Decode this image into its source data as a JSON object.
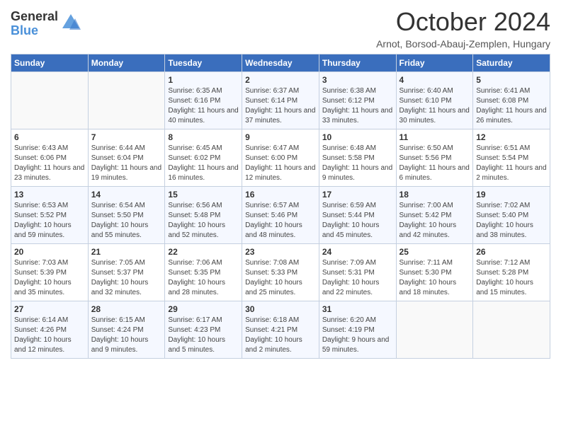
{
  "logo": {
    "general": "General",
    "blue": "Blue"
  },
  "title": "October 2024",
  "subtitle": "Arnot, Borsod-Abauj-Zemplen, Hungary",
  "days_of_week": [
    "Sunday",
    "Monday",
    "Tuesday",
    "Wednesday",
    "Thursday",
    "Friday",
    "Saturday"
  ],
  "weeks": [
    [
      {
        "day": "",
        "info": ""
      },
      {
        "day": "",
        "info": ""
      },
      {
        "day": "1",
        "info": "Sunrise: 6:35 AM\nSunset: 6:16 PM\nDaylight: 11 hours and 40 minutes."
      },
      {
        "day": "2",
        "info": "Sunrise: 6:37 AM\nSunset: 6:14 PM\nDaylight: 11 hours and 37 minutes."
      },
      {
        "day": "3",
        "info": "Sunrise: 6:38 AM\nSunset: 6:12 PM\nDaylight: 11 hours and 33 minutes."
      },
      {
        "day": "4",
        "info": "Sunrise: 6:40 AM\nSunset: 6:10 PM\nDaylight: 11 hours and 30 minutes."
      },
      {
        "day": "5",
        "info": "Sunrise: 6:41 AM\nSunset: 6:08 PM\nDaylight: 11 hours and 26 minutes."
      }
    ],
    [
      {
        "day": "6",
        "info": "Sunrise: 6:43 AM\nSunset: 6:06 PM\nDaylight: 11 hours and 23 minutes."
      },
      {
        "day": "7",
        "info": "Sunrise: 6:44 AM\nSunset: 6:04 PM\nDaylight: 11 hours and 19 minutes."
      },
      {
        "day": "8",
        "info": "Sunrise: 6:45 AM\nSunset: 6:02 PM\nDaylight: 11 hours and 16 minutes."
      },
      {
        "day": "9",
        "info": "Sunrise: 6:47 AM\nSunset: 6:00 PM\nDaylight: 11 hours and 12 minutes."
      },
      {
        "day": "10",
        "info": "Sunrise: 6:48 AM\nSunset: 5:58 PM\nDaylight: 11 hours and 9 minutes."
      },
      {
        "day": "11",
        "info": "Sunrise: 6:50 AM\nSunset: 5:56 PM\nDaylight: 11 hours and 6 minutes."
      },
      {
        "day": "12",
        "info": "Sunrise: 6:51 AM\nSunset: 5:54 PM\nDaylight: 11 hours and 2 minutes."
      }
    ],
    [
      {
        "day": "13",
        "info": "Sunrise: 6:53 AM\nSunset: 5:52 PM\nDaylight: 10 hours and 59 minutes."
      },
      {
        "day": "14",
        "info": "Sunrise: 6:54 AM\nSunset: 5:50 PM\nDaylight: 10 hours and 55 minutes."
      },
      {
        "day": "15",
        "info": "Sunrise: 6:56 AM\nSunset: 5:48 PM\nDaylight: 10 hours and 52 minutes."
      },
      {
        "day": "16",
        "info": "Sunrise: 6:57 AM\nSunset: 5:46 PM\nDaylight: 10 hours and 48 minutes."
      },
      {
        "day": "17",
        "info": "Sunrise: 6:59 AM\nSunset: 5:44 PM\nDaylight: 10 hours and 45 minutes."
      },
      {
        "day": "18",
        "info": "Sunrise: 7:00 AM\nSunset: 5:42 PM\nDaylight: 10 hours and 42 minutes."
      },
      {
        "day": "19",
        "info": "Sunrise: 7:02 AM\nSunset: 5:40 PM\nDaylight: 10 hours and 38 minutes."
      }
    ],
    [
      {
        "day": "20",
        "info": "Sunrise: 7:03 AM\nSunset: 5:39 PM\nDaylight: 10 hours and 35 minutes."
      },
      {
        "day": "21",
        "info": "Sunrise: 7:05 AM\nSunset: 5:37 PM\nDaylight: 10 hours and 32 minutes."
      },
      {
        "day": "22",
        "info": "Sunrise: 7:06 AM\nSunset: 5:35 PM\nDaylight: 10 hours and 28 minutes."
      },
      {
        "day": "23",
        "info": "Sunrise: 7:08 AM\nSunset: 5:33 PM\nDaylight: 10 hours and 25 minutes."
      },
      {
        "day": "24",
        "info": "Sunrise: 7:09 AM\nSunset: 5:31 PM\nDaylight: 10 hours and 22 minutes."
      },
      {
        "day": "25",
        "info": "Sunrise: 7:11 AM\nSunset: 5:30 PM\nDaylight: 10 hours and 18 minutes."
      },
      {
        "day": "26",
        "info": "Sunrise: 7:12 AM\nSunset: 5:28 PM\nDaylight: 10 hours and 15 minutes."
      }
    ],
    [
      {
        "day": "27",
        "info": "Sunrise: 6:14 AM\nSunset: 4:26 PM\nDaylight: 10 hours and 12 minutes."
      },
      {
        "day": "28",
        "info": "Sunrise: 6:15 AM\nSunset: 4:24 PM\nDaylight: 10 hours and 9 minutes."
      },
      {
        "day": "29",
        "info": "Sunrise: 6:17 AM\nSunset: 4:23 PM\nDaylight: 10 hours and 5 minutes."
      },
      {
        "day": "30",
        "info": "Sunrise: 6:18 AM\nSunset: 4:21 PM\nDaylight: 10 hours and 2 minutes."
      },
      {
        "day": "31",
        "info": "Sunrise: 6:20 AM\nSunset: 4:19 PM\nDaylight: 9 hours and 59 minutes."
      },
      {
        "day": "",
        "info": ""
      },
      {
        "day": "",
        "info": ""
      }
    ]
  ]
}
